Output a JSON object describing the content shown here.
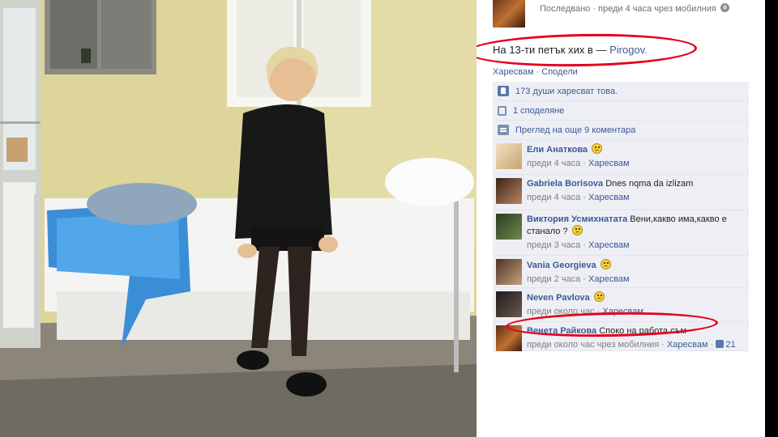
{
  "post": {
    "meta": "Последвано · преди 4 часа чрез мобилния",
    "globe_icon": "globe-icon",
    "caption_text": "На 13-ти петък хих в —",
    "caption_place": "Pirogov.",
    "actions": {
      "like": "Харесвам",
      "share": "Сподели"
    }
  },
  "stats": {
    "likes": "173 души харесват това.",
    "shares": "1 споделяне",
    "more_comments": "Преглед на още 9 коментара"
  },
  "comments": [
    {
      "name": "Ели Анаткова",
      "text": "",
      "smiley": true,
      "time": "преди 4 часа",
      "like": "Харесвам",
      "likes": ""
    },
    {
      "name": "Gabriela Borisova",
      "text": "Dnes nqma da izlizam",
      "smiley": false,
      "time": "преди 4 часа",
      "like": "Харесвам",
      "likes": ""
    },
    {
      "name": "Виктория Усмихнатата",
      "text": "Вени,какво има,какво е станало ?",
      "smiley": true,
      "time": "преди 3 часа",
      "like": "Харесвам",
      "likes": ""
    },
    {
      "name": "Vania Georgieva",
      "text": "",
      "smiley": true,
      "time": "преди 2 часа",
      "like": "Харесвам",
      "likes": ""
    },
    {
      "name": "Neven Pavlova",
      "text": "",
      "smiley": true,
      "time": "преди около час",
      "like": "Харесвам",
      "likes": ""
    },
    {
      "name": "Венета Райкова",
      "text": "Спoко на работа съм",
      "smiley": false,
      "time": "преди около час чрез мобилния",
      "like": "Харесвам",
      "likes": "21"
    }
  ],
  "colors": {
    "link": "#3b5998",
    "highlight": "#e3001b",
    "panel": "#edeff4"
  }
}
